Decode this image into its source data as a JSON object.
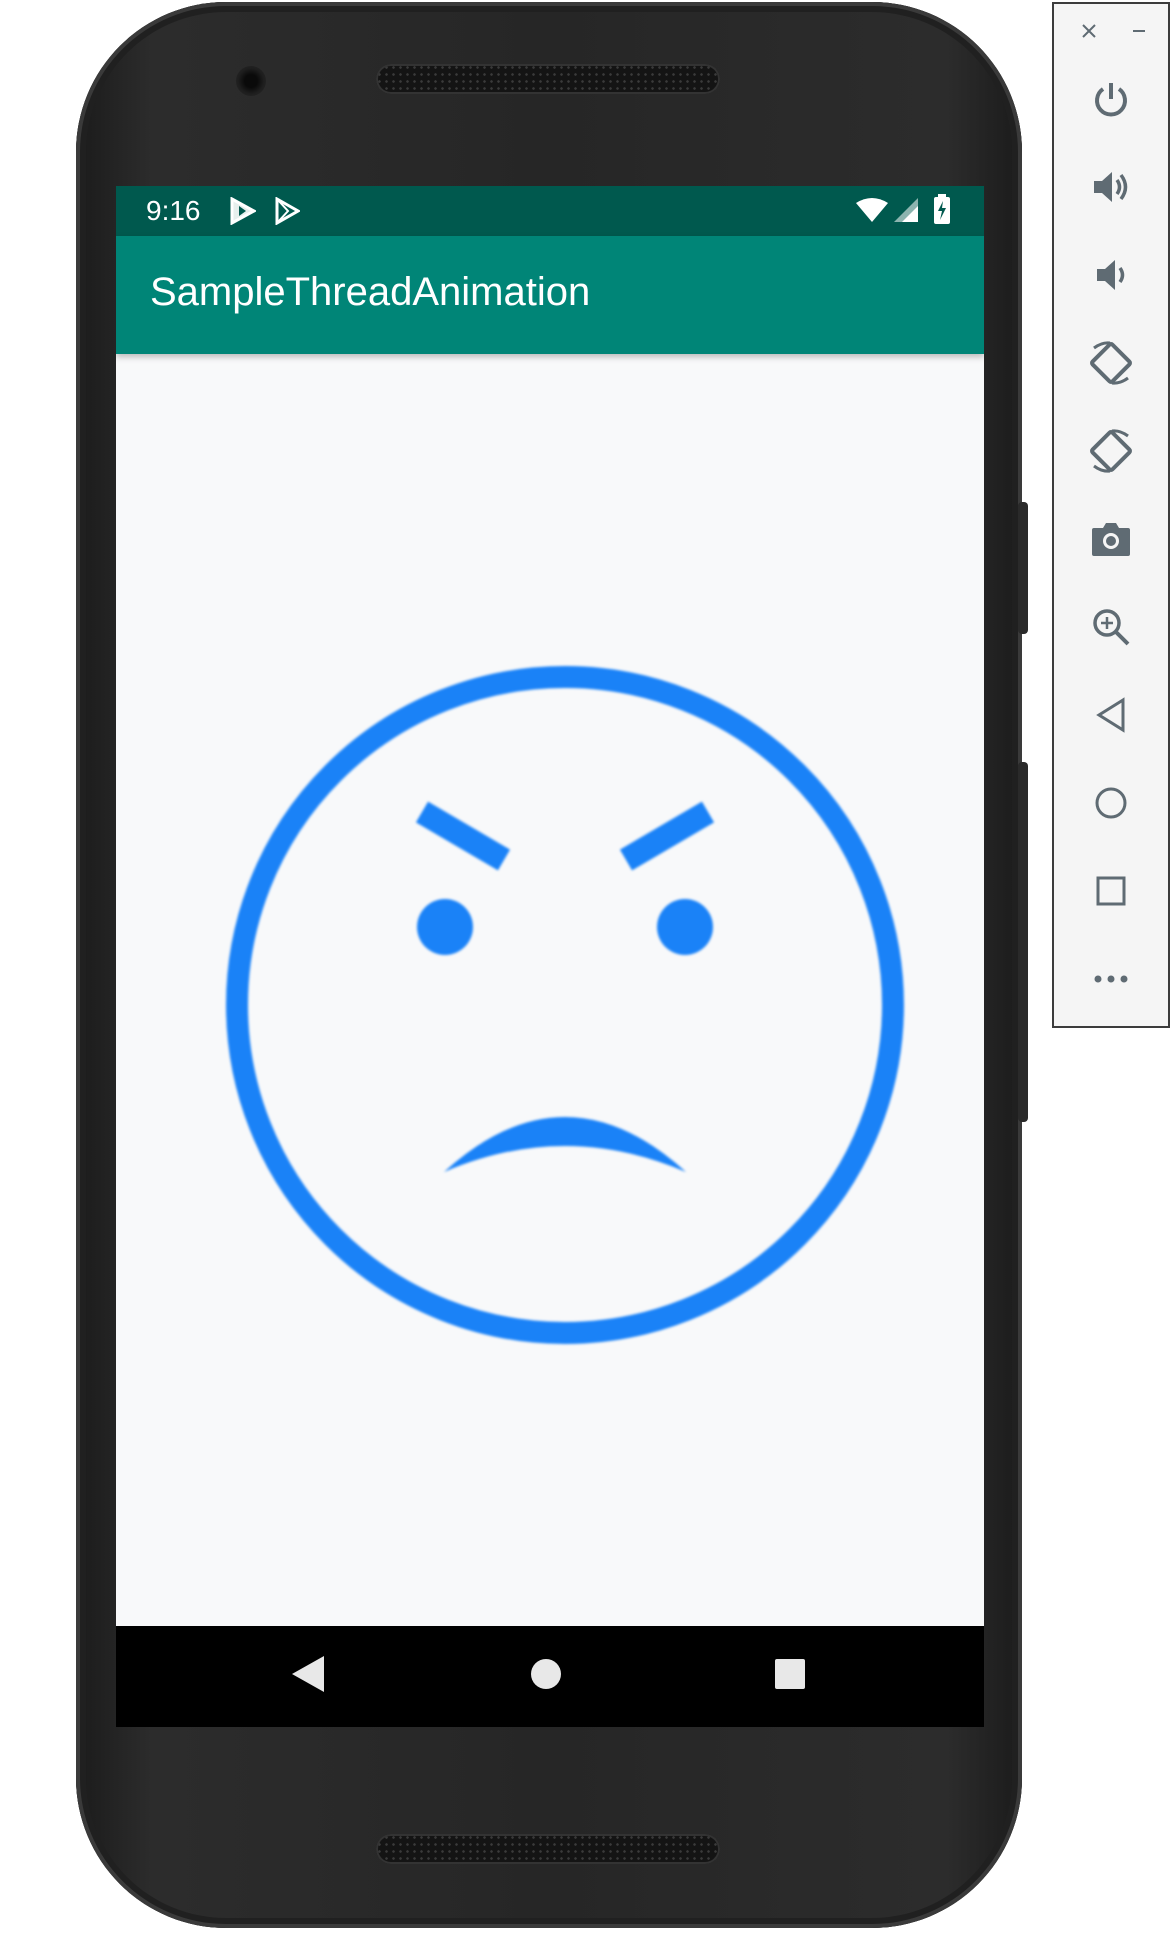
{
  "status_bar": {
    "time": "9:16"
  },
  "app_bar": {
    "title": "SampleThreadAnimation"
  },
  "face": {
    "expression": "angry-face",
    "color": "#1a82f7"
  },
  "colors": {
    "status_bar": "#00594e",
    "app_bar": "#008577",
    "screen_bg": "#f8f9fa",
    "nav_bar": "#000000",
    "toolbar_icon": "#5f6b73"
  },
  "nav_bar": {
    "buttons": [
      "back-icon",
      "home-icon",
      "recents-icon"
    ]
  },
  "emulator_toolbar": {
    "buttons": [
      "close-icon",
      "minimize-icon",
      "power-icon",
      "volume-up-icon",
      "volume-down-icon",
      "rotate-left-icon",
      "rotate-right-icon",
      "camera-icon",
      "zoom-icon",
      "back-icon",
      "home-icon",
      "overview-icon",
      "more-icon"
    ]
  }
}
